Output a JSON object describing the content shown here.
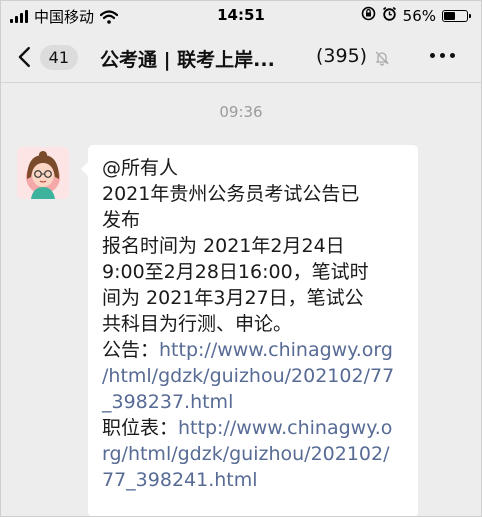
{
  "status_bar": {
    "carrier": "中国移动",
    "time": "14:51",
    "battery_percent": "56%",
    "battery_level": 0.56
  },
  "nav": {
    "unread_count": "41",
    "title": "公考通 | 联考上岸...",
    "member_count": "(395)"
  },
  "chat": {
    "timestamp": "09:36",
    "message_lines": [
      {
        "text": "@所有人",
        "link": false
      },
      {
        "text": "2021年贵州公务员考试公告已",
        "link": false
      },
      {
        "text": "发布",
        "link": false
      },
      {
        "text": "报名时间为 2021年2月24日",
        "link": false
      },
      {
        "text": "9:00至2月28日16:00，笔试时",
        "link": false
      },
      {
        "text": "间为 2021年3月27日，笔试公",
        "link": false
      },
      {
        "text": "共科目为行测、申论。",
        "link": false
      }
    ],
    "notice_label": "公告：",
    "notice_link_lines": [
      "http://www.chinagwy.org",
      "/html/gdzk/guizhou/202102/77",
      "_398237.html"
    ],
    "positions_label": "职位表：",
    "positions_link_lines": [
      "http://www.chinagwy.o",
      "rg/html/gdzk/guizhou/202102/",
      "77_398241.html"
    ]
  },
  "colors": {
    "background": "#ededed",
    "bubble": "#ffffff",
    "link": "#576b95",
    "timestamp": "#9b9b9b"
  }
}
